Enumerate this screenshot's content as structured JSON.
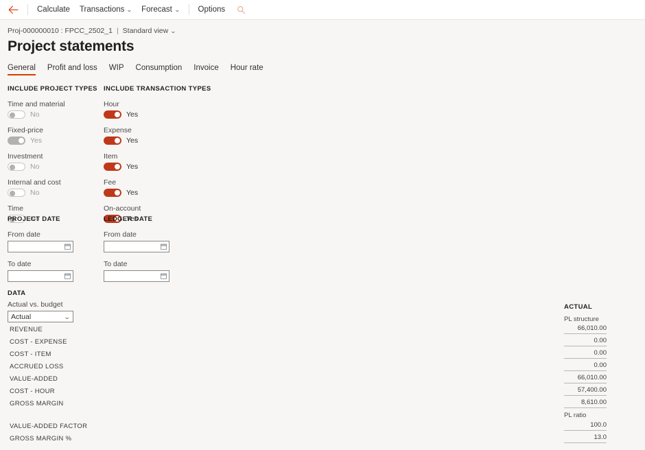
{
  "commandbar": {
    "back_icon": "back-arrow-icon",
    "items": [
      {
        "label": "Calculate",
        "has_chevron": false
      },
      {
        "label": "Transactions",
        "has_chevron": true
      },
      {
        "label": "Forecast",
        "has_chevron": true
      },
      {
        "label": "Options",
        "has_chevron": false
      }
    ],
    "search_icon": "search-icon",
    "chevron": "⌄"
  },
  "breadcrumb": {
    "record": "Proj-000000010 : FPCC_2502_1",
    "separator": "|",
    "view": "Standard view",
    "chevron": "⌄"
  },
  "page_title": "Project statements",
  "tabs": [
    {
      "label": "General",
      "active": true
    },
    {
      "label": "Profit and loss",
      "active": false
    },
    {
      "label": "WIP",
      "active": false
    },
    {
      "label": "Consumption",
      "active": false
    },
    {
      "label": "Invoice",
      "active": false
    },
    {
      "label": "Hour rate",
      "active": false
    }
  ],
  "project_types": {
    "heading": "INCLUDE PROJECT TYPES",
    "items": [
      {
        "label": "Time and material",
        "value": "No",
        "state": "off"
      },
      {
        "label": "Fixed-price",
        "value": "Yes",
        "state": "on-dis"
      },
      {
        "label": "Investment",
        "value": "No",
        "state": "off"
      },
      {
        "label": "Internal and cost",
        "value": "No",
        "state": "off"
      },
      {
        "label": "Time",
        "value": "No",
        "state": "off"
      }
    ]
  },
  "transaction_types": {
    "heading": "INCLUDE TRANSACTION TYPES",
    "items": [
      {
        "label": "Hour",
        "value": "Yes",
        "state": "on"
      },
      {
        "label": "Expense",
        "value": "Yes",
        "state": "on"
      },
      {
        "label": "Item",
        "value": "Yes",
        "state": "on"
      },
      {
        "label": "Fee",
        "value": "Yes",
        "state": "on"
      },
      {
        "label": "On-account",
        "value": "Yes",
        "state": "on"
      }
    ]
  },
  "project_date": {
    "heading": "PROJECT DATE",
    "from_label": "From date",
    "from_value": "",
    "to_label": "To date",
    "to_value": "",
    "calendar_icon": "calendar-icon"
  },
  "ledger_date": {
    "heading": "LEDGER DATE",
    "from_label": "From date",
    "from_value": "",
    "to_label": "To date",
    "to_value": "",
    "calendar_icon": "calendar-icon"
  },
  "data_section": {
    "heading": "DATA",
    "field_label": "Actual vs. budget",
    "selected": "Actual",
    "options": [
      "Actual"
    ],
    "chevron": "⌄"
  },
  "results": {
    "column_header": "ACTUAL",
    "group1_header": "PL structure",
    "group2_header": "PL ratio",
    "rows_structure": [
      {
        "label": "REVENUE",
        "value": "66,010.00"
      },
      {
        "label": "COST - EXPENSE",
        "value": "0.00"
      },
      {
        "label": "COST - ITEM",
        "value": "0.00"
      },
      {
        "label": "ACCRUED LOSS",
        "value": "0.00"
      },
      {
        "label": "VALUE-ADDED",
        "value": "66,010.00"
      },
      {
        "label": "COST - HOUR",
        "value": "57,400.00"
      },
      {
        "label": "GROSS MARGIN",
        "value": "8,610.00"
      }
    ],
    "rows_ratio": [
      {
        "label": "VALUE-ADDED FACTOR",
        "value": "100.0"
      },
      {
        "label": "GROSS MARGIN %",
        "value": "13.0"
      }
    ]
  },
  "colors": {
    "accent": "#d83b01",
    "toggle_on": "#c0381a",
    "toggle_disabled": "#b3b0ad",
    "background": "#f7f6f4"
  }
}
